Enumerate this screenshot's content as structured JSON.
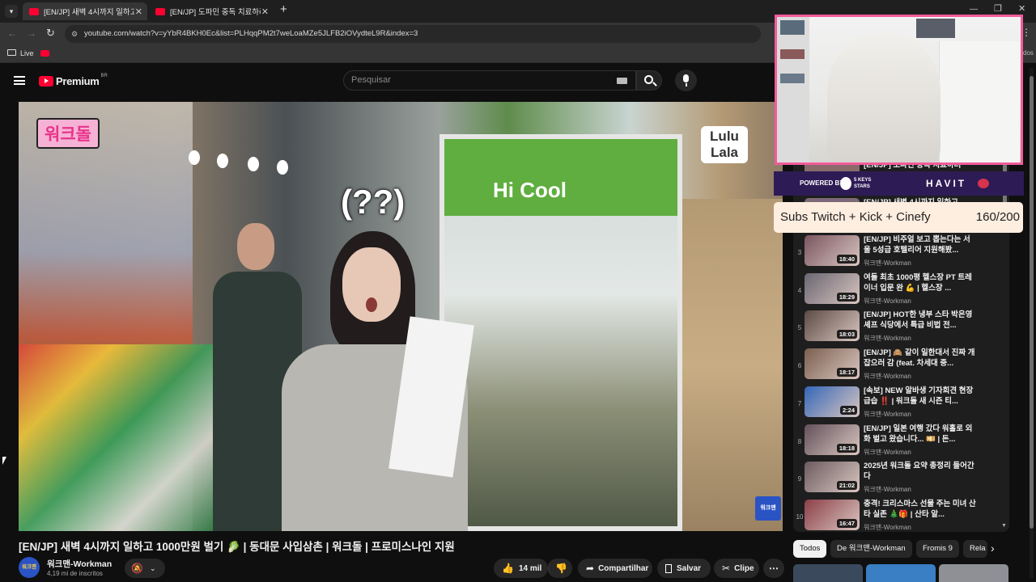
{
  "browser": {
    "tabs": [
      {
        "title": "[EN/JP] 새벽 4시까지 일하고 10",
        "active": true
      },
      {
        "title": "[EN/JP] 도파민 중독 치료하러 간",
        "active": false
      }
    ],
    "new_tab": "+",
    "url": "youtube.com/watch?v=yYbR4BKH0Ec&list=PLHqqPM2t7weLoaMZe5JLFB2iOVydteL9R&index=3",
    "bookmark_live": "Live",
    "bookmark_tail": "dos"
  },
  "header": {
    "logo_text": "Premium",
    "logo_superscript": "BR",
    "search_placeholder": "Pesquisar"
  },
  "video": {
    "title": "[EN/JP] 새벽 4시까지 일하고 1000만원 벌기 🥬 | 동대문 사입삼촌 | 워크돌 | 프로미스나인 지원",
    "overlay_logo": "워크돌",
    "overlay_bubble": "(??)",
    "overlay_brand_1": "Lulu",
    "overlay_brand_2": "Lala",
    "overlay_sign": "Hi Cool",
    "overlay_watermark": "워크맨"
  },
  "channel": {
    "name": "워크맨-Workman",
    "subscribers": "4,19 mi de inscritos",
    "avatar_text": "워크맨"
  },
  "actions": {
    "likes": "14 mil",
    "share": "Compartilhar",
    "save": "Salvar",
    "clip": "Clipe",
    "more": "⋯"
  },
  "playlist": {
    "partial_rows": [
      {
        "title": "[EN/JP] 도파민 중독 치료하러",
        "channel": ""
      },
      {
        "title": "[EN/JP] 새벽 4시까지 일하고",
        "channel": ""
      }
    ],
    "items": [
      {
        "index": "3",
        "title": "[EN/JP] 비주얼 보고 뽑는다는 서울 5성급 호텔리어 지원해봤...",
        "channel": "워크맨-Workman",
        "duration": "18:40"
      },
      {
        "index": "4",
        "title": "여돌 최초 1000평 헬스장 PT 트레이너 입문 완 💪 | 헬스장 ...",
        "channel": "워크맨-Workman",
        "duration": "18:29"
      },
      {
        "index": "5",
        "title": "[EN/JP] HOT한 냉부 스타 박은영 셰프 식당에서 특급 비법 전...",
        "channel": "워크맨-Workman",
        "duration": "18:03"
      },
      {
        "index": "6",
        "title": "[EN/JP] 🙈 같이 일한대서 진짜 개 잡으러 감 (feat. 차세대 중...",
        "channel": "워크맨-Workman",
        "duration": "18:17"
      },
      {
        "index": "7",
        "title": "[속보] NEW 알바생 기자회견 현장 급습 ‼️ | 워크돌 새 시즌 티...",
        "channel": "워크맨-Workman",
        "duration": "2:24"
      },
      {
        "index": "8",
        "title": "[EN/JP] 일본 여행 갔다 워홀로 외화 벌고 왔습니다... 💴 | 돈...",
        "channel": "워크맨-Workman",
        "duration": "18:18"
      },
      {
        "index": "9",
        "title": "2025년 워크돌 요약 총정리 들어간다",
        "channel": "워크맨-Workman",
        "duration": "21:02"
      },
      {
        "index": "10",
        "title": "충격! 크리스마스 선물 주는 미녀 산타 실존 🎄🎁 | 산타 알...",
        "channel": "워크맨-Workman",
        "duration": "16:47"
      }
    ]
  },
  "chips": [
    "Todos",
    "De 워크맨-Workman",
    "Fromis 9",
    "Rela"
  ],
  "stream_overlay": {
    "powered_by": "POWERED BY",
    "partner_1": "5 KEYS STARS",
    "partner_2": "HAVIT",
    "subs_text": "Subs Twitch + Kick + Cinefy",
    "subs_count": "160/200"
  },
  "colors": {
    "youtube_red": "#ff0033",
    "webcam_border": "#f25c9a",
    "sponsor_bg": "#2d1b55",
    "subs_banner_bg": "#fdeee0"
  }
}
